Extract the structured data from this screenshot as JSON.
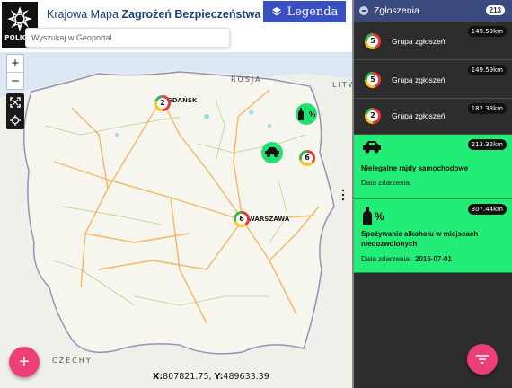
{
  "app": {
    "title_prefix": "Krajowa Mapa ",
    "title_bold": "Zagrożeń Bezpieczeństwa",
    "logo_text": "POLICJA"
  },
  "legend_button": {
    "label": "Legenda",
    "icon": "layers-icon"
  },
  "search": {
    "placeholder": "Wyszukaj w Geoportal",
    "value": ""
  },
  "map_controls": {
    "zoom_in": "+",
    "zoom_out": "−",
    "fullscreen_icon": "fullscreen-icon",
    "locate_icon": "locate-icon"
  },
  "map": {
    "country_labels": {
      "russia": "ROSJA",
      "lithuania": "LITW",
      "czech": "CZECHY"
    },
    "cities": [
      "GDAŃSK",
      "WARSZAWA"
    ],
    "clusters": [
      {
        "count": "2",
        "near": "GDAŃSK"
      },
      {
        "count": "6",
        "near": "WARSZAWA"
      },
      {
        "count": "6",
        "near": "east"
      }
    ],
    "markers": [
      {
        "icon": "alcohol-icon",
        "label": "%"
      },
      {
        "icon": "car-race-icon",
        "label": ""
      }
    ],
    "coords": {
      "x_label": "X:",
      "x_value": "807821.75,",
      "y_label": "Y:",
      "y_value": "489633.39"
    }
  },
  "panel": {
    "title": "Zgłoszenia",
    "count": "213",
    "groups": [
      {
        "count": "5",
        "label": "Grupa zgłoszeń",
        "distance": "149.59km"
      },
      {
        "count": "5",
        "label": "Grupa zgłoszeń",
        "distance": "149.59km"
      },
      {
        "count": "2",
        "label": "Grupa zgłoszeń",
        "distance": "182.33km"
      }
    ],
    "reports": [
      {
        "icon": "car-race-icon",
        "title": "Nielegalne rajdy samochodowe",
        "date_label": "Data zdarzenia:",
        "date_value": "",
        "distance": "213.32km"
      },
      {
        "icon": "alcohol-icon",
        "title_line1": "Spożywanie alkoholu w miejscach",
        "title_line2": "niedozwolonych",
        "date_label": "Data zdarzenia:",
        "date_value": "2016-07-01",
        "distance": "307.44km",
        "icon_label": "%"
      }
    ]
  },
  "fab": {
    "add": "+",
    "filter_icon": "filter-icon"
  },
  "colors": {
    "accent": "#ec3f78",
    "legend": "#3b4fc4",
    "panel_header": "#3b4a7e",
    "report_green": "#22ee77",
    "panel_bg": "#2d2d2d"
  }
}
